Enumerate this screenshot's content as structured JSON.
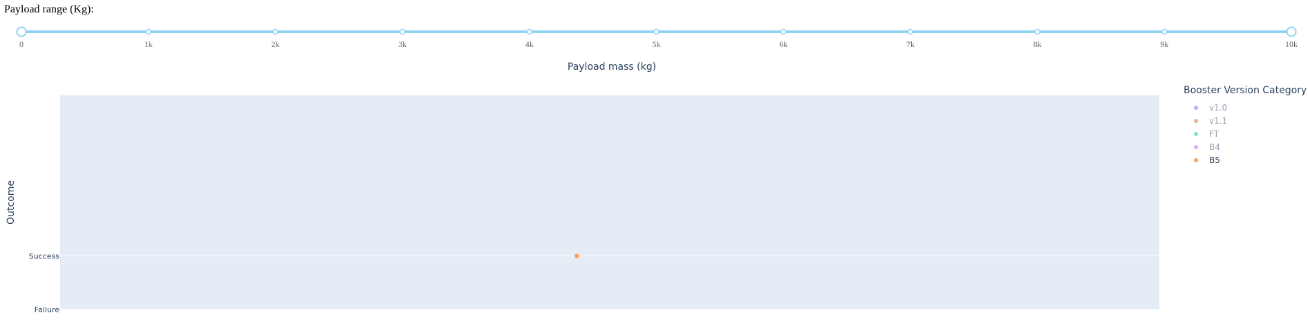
{
  "slider": {
    "title": "Payload range (Kg):",
    "min": 0,
    "max": 10000,
    "value": [
      0,
      10000
    ],
    "marks": [
      {
        "value": 0,
        "label": "0"
      },
      {
        "value": 1000,
        "label": "1k"
      },
      {
        "value": 2000,
        "label": "2k"
      },
      {
        "value": 3000,
        "label": "3k"
      },
      {
        "value": 4000,
        "label": "4k"
      },
      {
        "value": 5000,
        "label": "5k"
      },
      {
        "value": 6000,
        "label": "6k"
      },
      {
        "value": 7000,
        "label": "7k"
      },
      {
        "value": 8000,
        "label": "8k"
      },
      {
        "value": 9000,
        "label": "9k"
      },
      {
        "value": 10000,
        "label": "10k"
      }
    ],
    "color": "#8fd3f4"
  },
  "chart_data": {
    "type": "scatter",
    "xlabel": "Payload mass (kg)",
    "ylabel": "Outcome",
    "y_categories": [
      "Failure",
      "Success"
    ],
    "legend_title": "Booster Version Category",
    "legend_position": "right",
    "grid": true,
    "series": [
      {
        "name": "v1.0",
        "color": "#636efa",
        "visible": false,
        "points": []
      },
      {
        "name": "v1.1",
        "color": "#ef553b",
        "visible": false,
        "points": []
      },
      {
        "name": "FT",
        "color": "#00cc96",
        "visible": false,
        "points": []
      },
      {
        "name": "B4",
        "color": "#ab63fa",
        "visible": false,
        "points": []
      },
      {
        "name": "B5",
        "color": "#ffa15a",
        "visible": true,
        "points": [
          {
            "x": 4700,
            "y": "Success"
          }
        ]
      }
    ],
    "xlim": [
      0,
      10000
    ],
    "plot_bg": "#e5ecf6"
  }
}
